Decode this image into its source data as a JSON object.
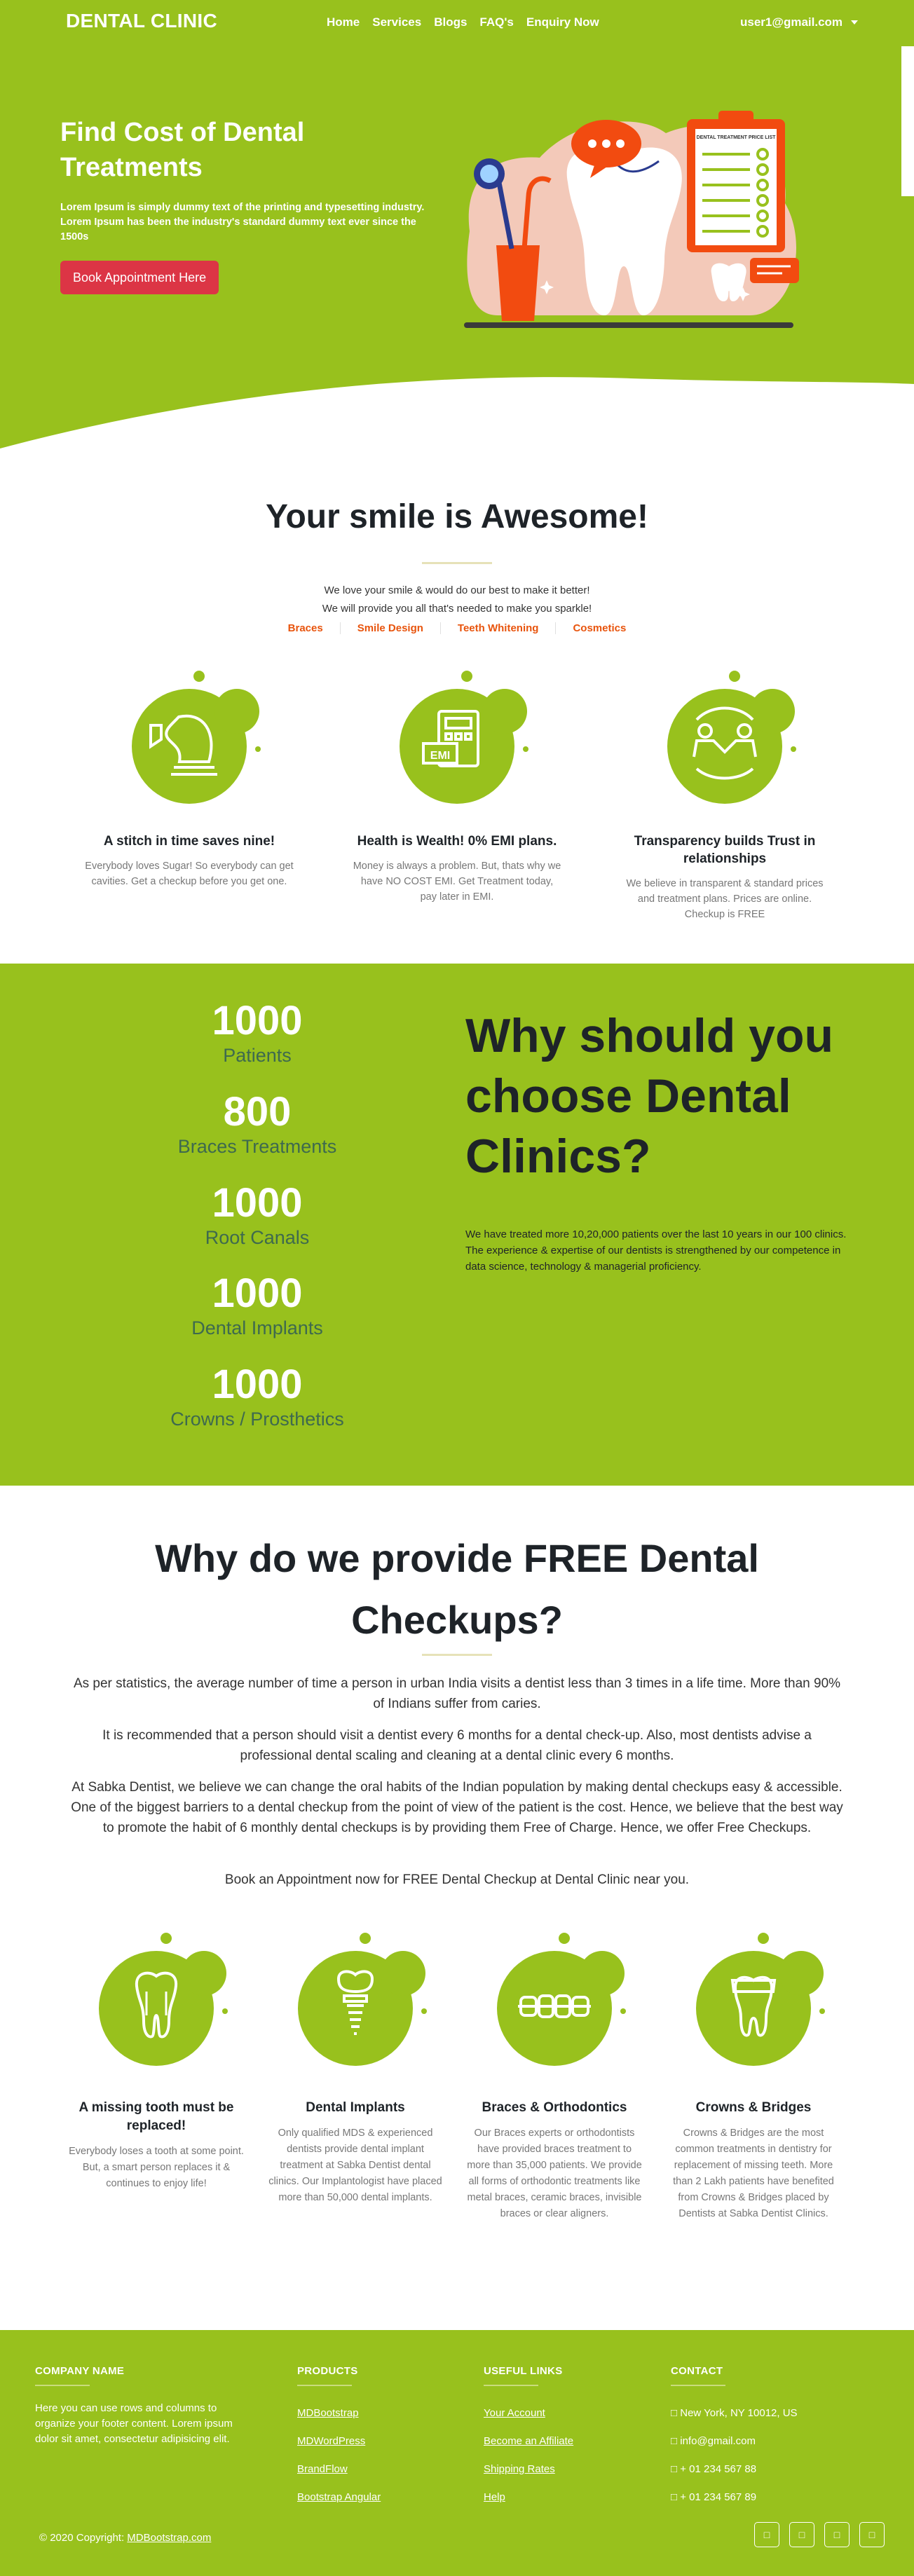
{
  "nav": {
    "brand": "DENTAL CLINIC",
    "items": [
      {
        "label": "Home"
      },
      {
        "label": "Services"
      },
      {
        "label": "Blogs"
      },
      {
        "label": "FAQ's"
      },
      {
        "label": "Enquiry Now"
      }
    ],
    "user": "user1@gmail.com"
  },
  "hero": {
    "title": "Find Cost of Dental Treatments",
    "text": "Lorem Ipsum is simply dummy text of the printing and typesetting industry. Lorem Ipsum has been the industry's standard dummy text ever since the 1500s",
    "button": "Book Appointment Here",
    "illustration": {
      "board_title": "DENTAL TREATMENT PRICE LIST",
      "icons": [
        "dental-mirror-icon",
        "tooth-icon",
        "chat-bubble-icon",
        "clipboard-icon"
      ]
    }
  },
  "smile": {
    "title": "Your smile is Awesome!",
    "sub1": "We love your smile & would do our best to make it better!",
    "sub2": "We will provide you all that's needed to make you sparkle!",
    "tabs": [
      "Braces",
      "Smile Design",
      "Teeth Whitening",
      "Cosmetics"
    ],
    "features": [
      {
        "icon": "chess-knight-icon",
        "title": "A stitch in time saves nine!",
        "text": "Everybody loves Sugar! So everybody can get cavities. Get a checkup before you get one."
      },
      {
        "icon": "emi-calculator-icon",
        "title": "Health is Wealth! 0% EMI plans.",
        "text": "Money is always a problem. But, thats why we have NO COST EMI. Get Treatment today, pay later in EMI."
      },
      {
        "icon": "handshake-people-icon",
        "title": "Transparency builds Trust in relationships",
        "text": "We believe in transparent & standard prices and treatment plans. Prices are online. Checkup is FREE"
      }
    ]
  },
  "stats": {
    "items": [
      {
        "number": "1000",
        "label": "Patients"
      },
      {
        "number": "800",
        "label": "Braces Treatments"
      },
      {
        "number": "1000",
        "label": "Root Canals"
      },
      {
        "number": "1000",
        "label": "Dental Implants"
      },
      {
        "number": "1000",
        "label": "Crowns / Prosthetics"
      }
    ],
    "title": "Why should you choose Dental Clinics?",
    "text": "We have treated more 10,20,000 patients over the last 10 years in our 100 clinics. The experience & expertise of our dentists is strengthened by our competence in data science, technology & managerial proficiency."
  },
  "free": {
    "title": "Why do we provide FREE Dental Checkups?",
    "paragraphs": [
      "As per statistics, the average number of time a person in urban India visits a dentist less than 3 times in a life time. More than 90% of Indians suffer from caries.",
      "It is recommended that a person should visit a dentist every 6 months for a dental check-up. Also, most dentists advise a professional dental scaling and cleaning at a dental clinic every 6 months.",
      "At Sabka Dentist, we believe we can change the oral habits of the Indian population by making dental checkups easy & accessible. One of the biggest barriers to a dental checkup from the point of view of the patient is the cost. Hence, we believe that the best way to promote the habit of 6 monthly dental checkups is by providing them Free of Charge. Hence, we offer Free Checkups.",
      "Book an Appointment now for FREE Dental Checkup at Dental Clinic near you."
    ],
    "features": [
      {
        "icon": "tooth-icon",
        "title": "A missing tooth must be replaced!",
        "text": "Everybody loses a tooth at some point. But, a smart person replaces it & continues to enjoy life!"
      },
      {
        "icon": "dental-implant-icon",
        "title": "Dental Implants",
        "text": "Only qualified MDS & experienced dentists provide dental implant treatment at Sabka Dentist dental clinics. Our Implantologist have placed more than 50,000 dental implants."
      },
      {
        "icon": "braces-icon",
        "title": "Braces & Orthodontics",
        "text": "Our Braces experts or orthodontists have provided braces treatment to more than 35,000 patients. We provide all forms of orthodontic treatments like metal braces, ceramic braces, invisible braces or clear aligners."
      },
      {
        "icon": "dental-crown-icon",
        "title": "Crowns & Bridges",
        "text": "Crowns & Bridges are the most common treatments in dentistry for replacement of missing teeth. More than 2 Lakh patients have benefited from Crowns & Bridges placed by Dentists at Sabka Dentist Clinics."
      }
    ]
  },
  "footer": {
    "company": {
      "title": "COMPANY NAME",
      "text": "Here you can use rows and columns to organize your footer content. Lorem ipsum dolor sit amet, consectetur adipisicing elit."
    },
    "products": {
      "title": "PRODUCTS",
      "links": [
        "MDBootstrap",
        "MDWordPress",
        "BrandFlow",
        "Bootstrap Angular"
      ]
    },
    "useful": {
      "title": "USEFUL LINKS",
      "links": [
        "Your Account",
        "Become an Affiliate",
        "Shipping Rates",
        "Help"
      ]
    },
    "contact": {
      "title": "CONTACT",
      "items": [
        "New York, NY 10012, US",
        "info@gmail.com",
        "+ 01 234 567 88",
        "+ 01 234 567 89"
      ]
    },
    "copyright_prefix": "© 2020 Copyright: ",
    "copyright_link": "MDBootstrap.com",
    "social": [
      "facebook-icon",
      "twitter-icon",
      "google-plus-icon",
      "linkedin-icon"
    ]
  },
  "colors": {
    "primary_green": "#98c11d",
    "accent_orange": "#e8540d",
    "button_red": "#dc3545",
    "stat_label": "#3e6a4e"
  }
}
